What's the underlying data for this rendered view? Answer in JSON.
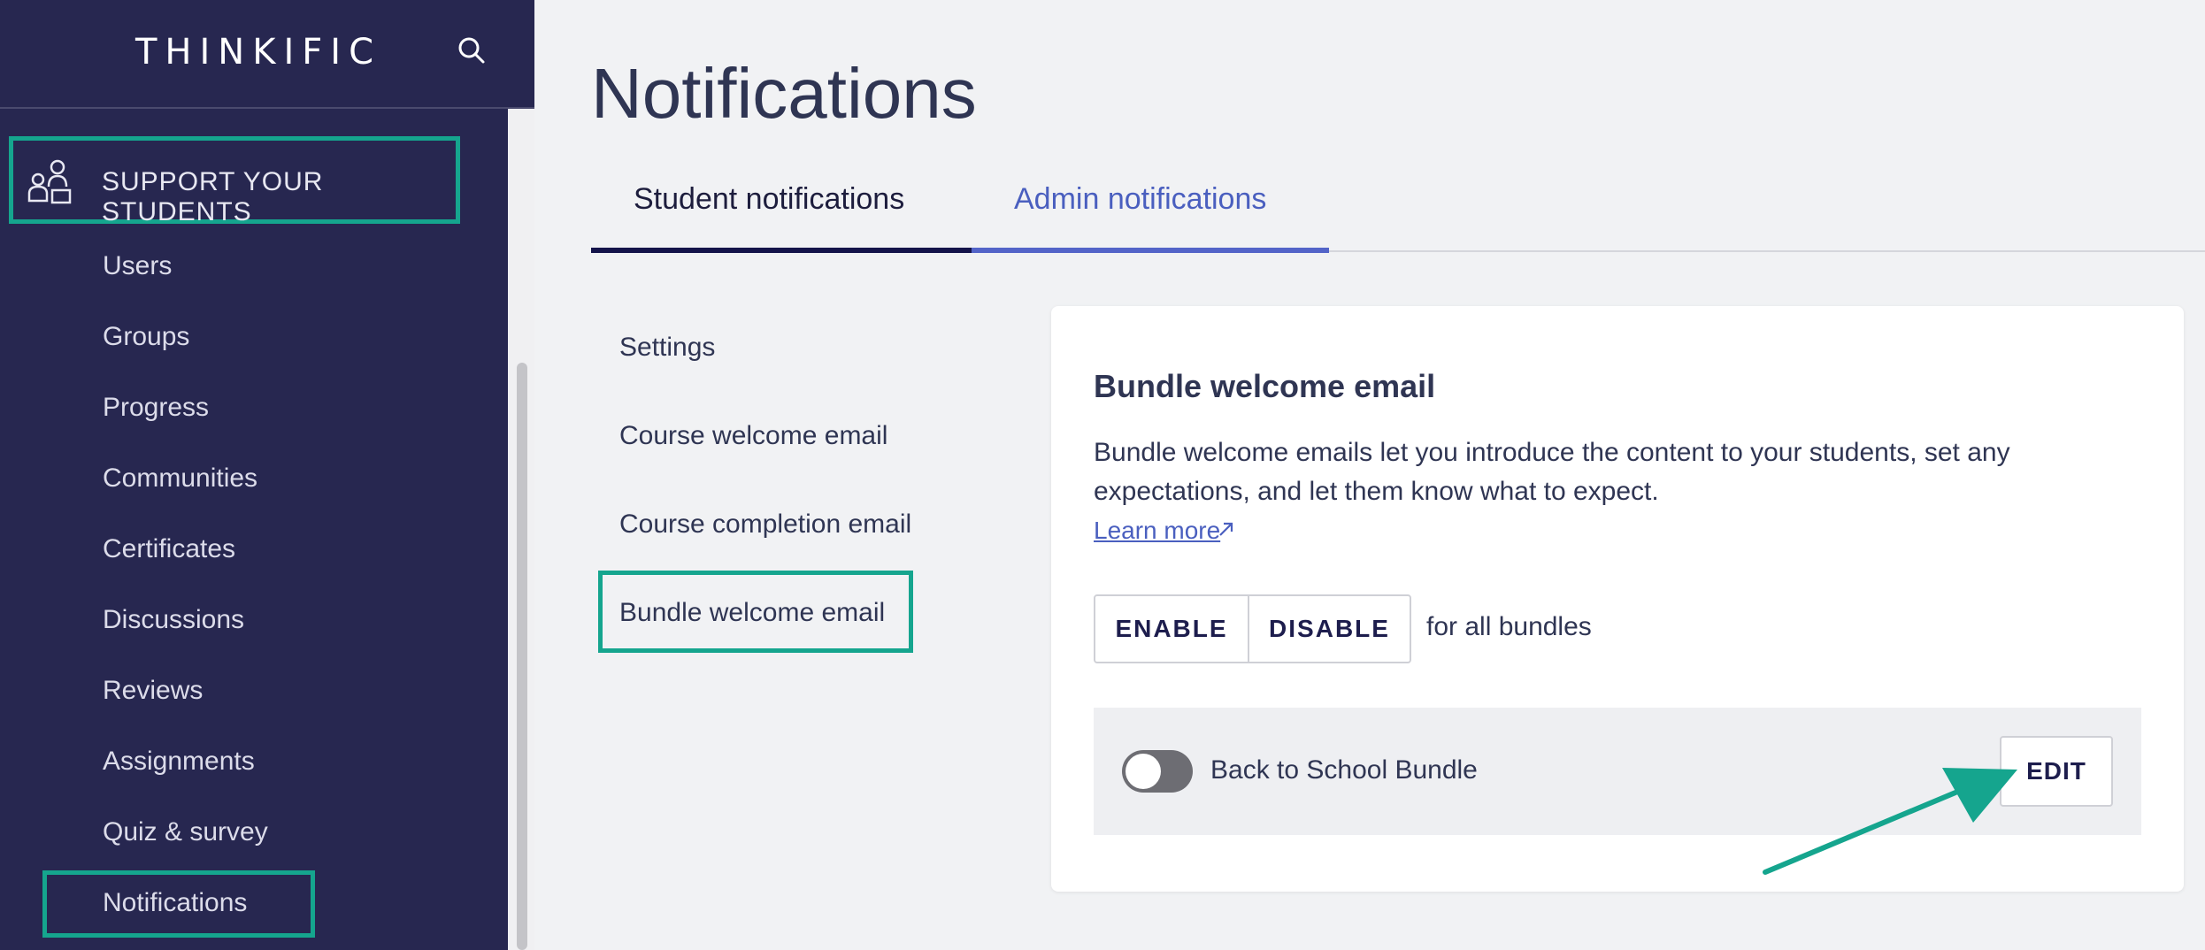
{
  "sidebar": {
    "logo": "THINKIFIC",
    "section_label": "SUPPORT YOUR STUDENTS",
    "items": [
      {
        "label": "Users"
      },
      {
        "label": "Groups"
      },
      {
        "label": "Progress"
      },
      {
        "label": "Communities"
      },
      {
        "label": "Certificates"
      },
      {
        "label": "Discussions"
      },
      {
        "label": "Reviews"
      },
      {
        "label": "Assignments"
      },
      {
        "label": "Quiz & survey"
      },
      {
        "label": "Notifications"
      }
    ],
    "icons": {
      "search": "search-icon",
      "section": "students-icon"
    }
  },
  "main": {
    "title": "Notifications",
    "tabs": [
      {
        "label": "Student notifications",
        "active": true
      },
      {
        "label": "Admin notifications",
        "active": false
      }
    ],
    "sub_nav": [
      {
        "label": "Settings"
      },
      {
        "label": "Course welcome email"
      },
      {
        "label": "Course completion email"
      },
      {
        "label": "Bundle welcome email",
        "active": true
      }
    ],
    "card": {
      "title": "Bundle welcome email",
      "description": "Bundle welcome emails let you introduce the content to your students, set any expectations, and let them know what to expect.",
      "learn_more": "Learn more",
      "enable_label": "ENABLE",
      "disable_label": "DISABLE",
      "for_all_text": "for all bundles",
      "bundle": {
        "name": "Back to School Bundle",
        "enabled": false,
        "edit_label": "EDIT"
      }
    }
  },
  "colors": {
    "sidebar_bg": "#272750",
    "highlight": "#15a58e",
    "accent": "#4a5fbf",
    "active_tab": "#14144a"
  }
}
